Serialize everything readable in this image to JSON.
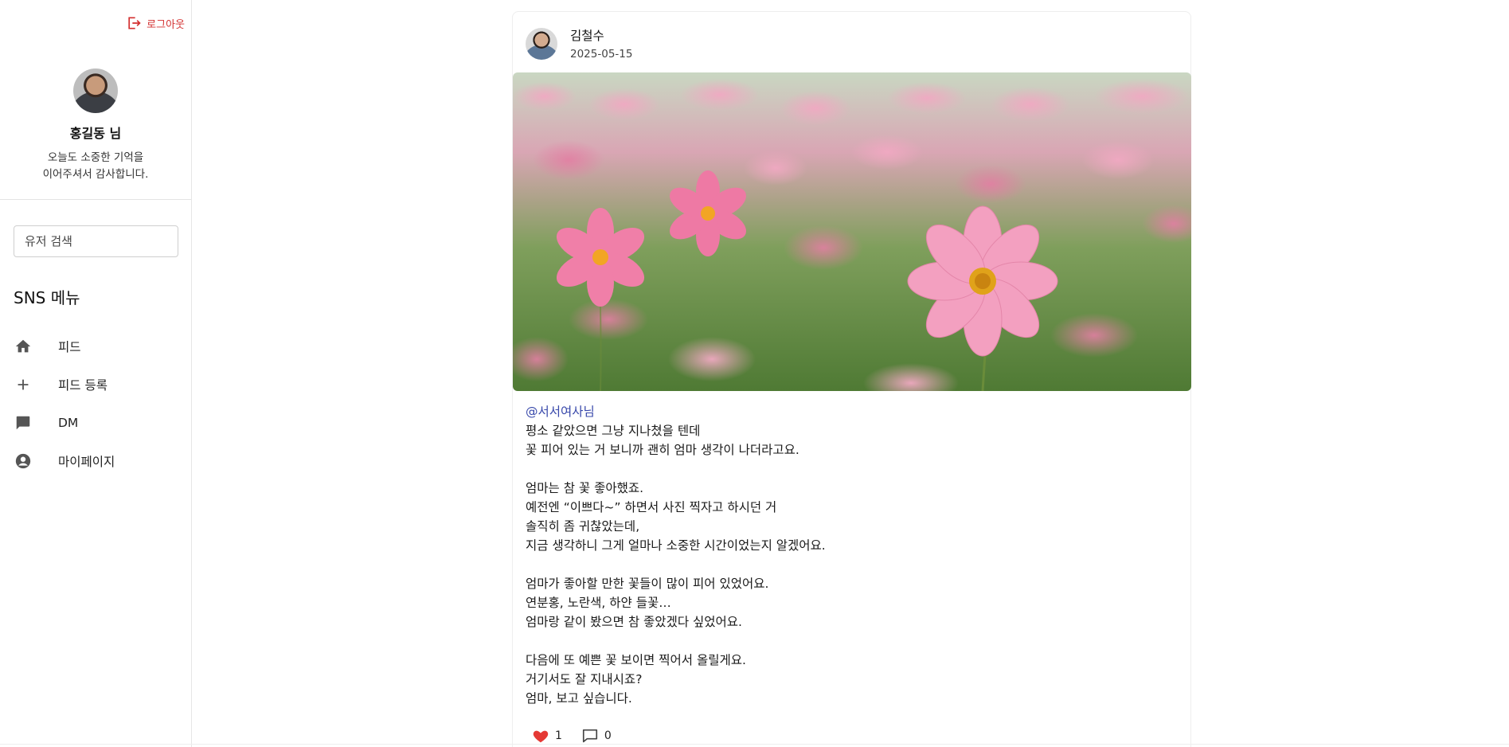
{
  "sidebar": {
    "logout_label": "로그아웃",
    "profile": {
      "name": "홍길동 님",
      "message_line1": "오늘도 소중한 기억을",
      "message_line2": "이어주셔서 감사합니다."
    },
    "search_placeholder": "유저 검색",
    "menu_title": "SNS 메뉴",
    "menu_items": [
      {
        "label": "피드",
        "icon": "home-icon"
      },
      {
        "label": "피드 등록",
        "icon": "plus-icon"
      },
      {
        "label": "DM",
        "icon": "chat-icon"
      },
      {
        "label": "마이페이지",
        "icon": "account-circle-icon"
      }
    ]
  },
  "post": {
    "author": "김철수",
    "date": "2025-05-15",
    "image_desc": "pink-cosmos-flowers-field",
    "mention": "@서서여사님",
    "lines": [
      "평소 같았으면 그냥 지나쳤을 텐데",
      "꽃 피어 있는 거 보니까 괜히 엄마 생각이 나더라고요.",
      "",
      "엄마는 참 꽃 좋아했죠.",
      "예전엔 “이쁘다~” 하면서 사진 찍자고 하시던 거",
      "솔직히 좀 귀찮았는데,",
      "지금 생각하니 그게 얼마나 소중한 시간이었는지 알겠어요.",
      "",
      "엄마가 좋아할 만한 꽃들이 많이 피어 있었어요.",
      "연분홍, 노란색, 하얀 들꽃…",
      "엄마랑 같이 봤으면 참 좋았겠다 싶었어요.",
      "",
      "다음에 또 예쁜 꽃 보이면 찍어서 올릴게요.",
      "거기서도 잘 지내시죠?",
      "엄마, 보고 싶습니다."
    ],
    "likes": "1",
    "comments": "0"
  },
  "colors": {
    "logout": "#d32f2f",
    "mention": "#3949ab",
    "like": "#e53935"
  }
}
